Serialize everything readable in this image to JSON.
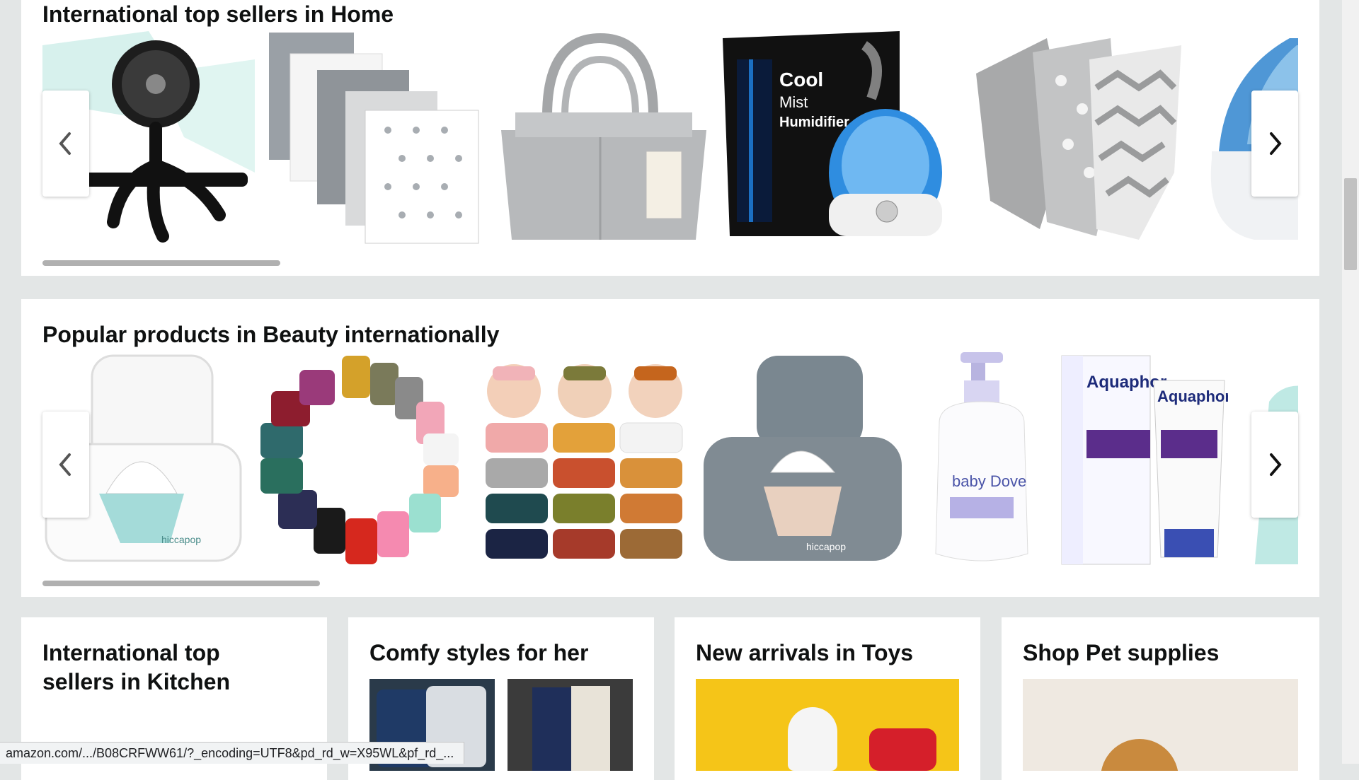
{
  "sections": [
    {
      "title": "International top sellers in Home",
      "items": [
        "Portable stroller fan with flexible tripod",
        "Receiving blankets set",
        "Felt diaper caddy organizer",
        "AquaOasis cool mist humidifier",
        "Baby swaddle wraps",
        "Ultrasonic humidifier"
      ],
      "humidifier_box_text": [
        "Cool",
        "Mist",
        "Humidifier"
      ]
    },
    {
      "title": "Popular products in Beauty internationally",
      "items": [
        "Hiccapop wipe warmer",
        "Baby headbands set",
        "Knotted baby headbands",
        "Grey wipe warmer",
        "Baby Dove wash",
        "Aquaphor diaper rash paste",
        "Clinical deodorant"
      ],
      "brand_texts": {
        "hiccapop": "hiccapop",
        "babydove": "baby Dove",
        "aquaphor": "Aquaphor"
      }
    }
  ],
  "bottom_cards": [
    {
      "title": "International top sellers in Kitchen"
    },
    {
      "title": "Comfy styles for her"
    },
    {
      "title": "New arrivals in Toys"
    },
    {
      "title": "Shop Pet supplies"
    }
  ],
  "status_url": "amazon.com/.../B08CRFWW61/?_encoding=UTF8&pd_rd_w=X95WL&pf_rd_...",
  "icons": {
    "prev": "chevron-left-icon",
    "next": "chevron-right-icon"
  }
}
